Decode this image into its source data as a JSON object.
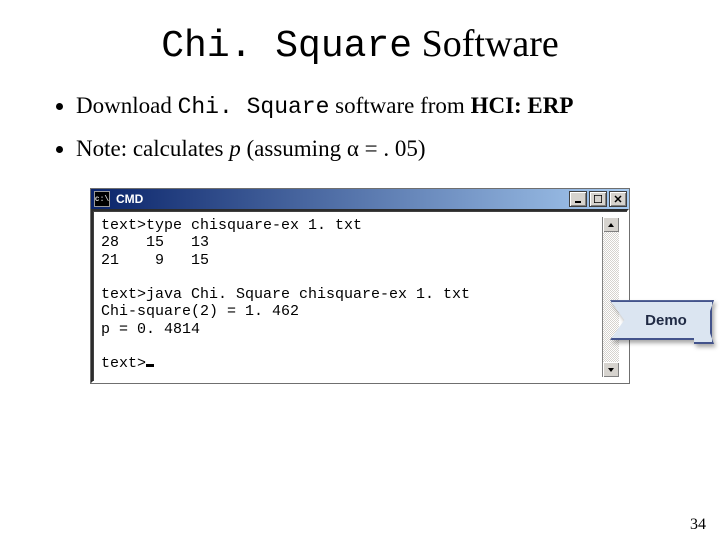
{
  "title": {
    "mono": "Chi. Square",
    "rest": " Software"
  },
  "bullets": [
    {
      "pre": "Download ",
      "mono": "Chi. Square",
      "mid": " software from ",
      "bold": "HCI: ERP"
    },
    {
      "pre": "Note: calculates ",
      "ital": "p",
      "mid": " (assuming α",
      "tail": " = . 05)"
    }
  ],
  "cmd": {
    "title": "CMD",
    "lines": "text>type chisquare-ex 1. txt\n28   15   13\n21    9   15\n\ntext>java Chi. Square chisquare-ex 1. txt\nChi-square(2) = 1. 462\np = 0. 4814\n\ntext>"
  },
  "demo_label": "Demo",
  "page_number": "34"
}
